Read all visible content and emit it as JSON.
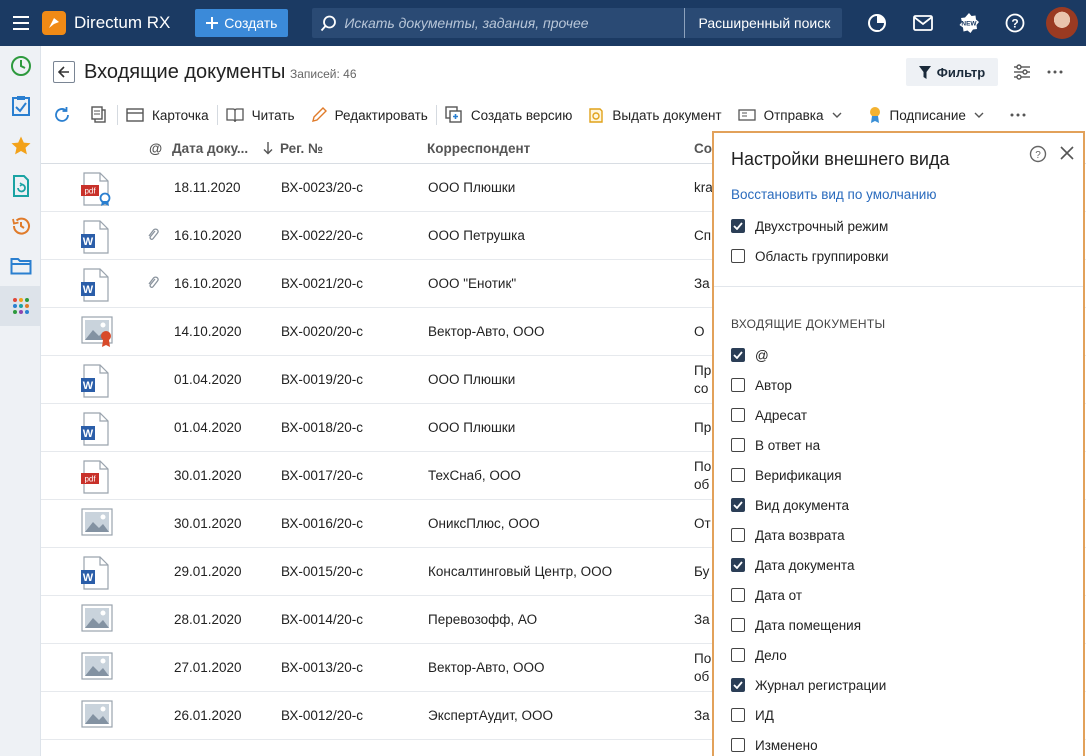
{
  "app": {
    "title": "Directum RX",
    "create_label": "Создать",
    "search_placeholder": "Искать документы, задания, прочее",
    "advanced_search": "Расширенный поиск"
  },
  "page": {
    "title": "Входящие документы",
    "count": "Записей: 46",
    "filter_label": "Фильтр"
  },
  "toolbar": {
    "card": "Карточка",
    "read": "Читать",
    "edit": "Редактировать",
    "create_version": "Создать версию",
    "issue_doc": "Выдать документ",
    "send": "Отправка",
    "sign": "Подписание"
  },
  "columns": {
    "at": "@",
    "date": "Дата доку...",
    "reg": "Рег. №",
    "corr": "Корреспондент",
    "content": "Со"
  },
  "rows": [
    {
      "icon": "pdf-signed",
      "attach": false,
      "date": "18.11.2020",
      "reg": "ВХ-0023/20-с",
      "corr": "ООО Плюшки",
      "c1": "kra",
      "c2": ""
    },
    {
      "icon": "word",
      "attach": true,
      "date": "16.10.2020",
      "reg": "ВХ-0022/20-с",
      "corr": "ООО Петрушка",
      "c1": "Сп",
      "c2": ""
    },
    {
      "icon": "word",
      "attach": true,
      "date": "16.10.2020",
      "reg": "ВХ-0021/20-с",
      "corr": "ООО \"Енотик\"",
      "c1": "За",
      "c2": ""
    },
    {
      "icon": "image-signed",
      "attach": false,
      "date": "14.10.2020",
      "reg": "ВХ-0020/20-с",
      "corr": "Вектор-Авто, ООО",
      "c1": "О",
      "c2": ""
    },
    {
      "icon": "word",
      "attach": false,
      "date": "01.04.2020",
      "reg": "ВХ-0019/20-с",
      "corr": "ООО Плюшки",
      "c1": "Пр",
      "c2": "со"
    },
    {
      "icon": "word",
      "attach": false,
      "date": "01.04.2020",
      "reg": "ВХ-0018/20-с",
      "corr": "ООО Плюшки",
      "c1": "Пр",
      "c2": ""
    },
    {
      "icon": "pdf",
      "attach": false,
      "date": "30.01.2020",
      "reg": "ВХ-0017/20-с",
      "corr": "ТехСнаб, ООО",
      "c1": "По",
      "c2": "об"
    },
    {
      "icon": "image",
      "attach": false,
      "date": "30.01.2020",
      "reg": "ВХ-0016/20-с",
      "corr": "ОниксПлюс, ООО",
      "c1": "От",
      "c2": ""
    },
    {
      "icon": "word",
      "attach": false,
      "date": "29.01.2020",
      "reg": "ВХ-0015/20-с",
      "corr": "Консалтинговый Центр, ООО",
      "c1": "Бу",
      "c2": ""
    },
    {
      "icon": "image",
      "attach": false,
      "date": "28.01.2020",
      "reg": "ВХ-0014/20-с",
      "corr": "Перевозофф, АО",
      "c1": "За",
      "c2": ""
    },
    {
      "icon": "image",
      "attach": false,
      "date": "27.01.2020",
      "reg": "ВХ-0013/20-с",
      "corr": "Вектор-Авто, ООО",
      "c1": "По",
      "c2": "об"
    },
    {
      "icon": "image",
      "attach": false,
      "date": "26.01.2020",
      "reg": "ВХ-0012/20-с",
      "corr": "ЭкспертАудит, ООО",
      "c1": "За",
      "c2": ""
    }
  ],
  "panel": {
    "title": "Настройки внешнего вида",
    "restore": "Восстановить вид по умолчанию",
    "options": [
      {
        "label": "Двухстрочный режим",
        "checked": true
      },
      {
        "label": "Область группировки",
        "checked": false
      }
    ],
    "section": "ВХОДЯЩИЕ ДОКУМЕНТЫ",
    "fields": [
      {
        "label": "@",
        "checked": true
      },
      {
        "label": "Автор",
        "checked": false
      },
      {
        "label": "Адресат",
        "checked": false
      },
      {
        "label": "В ответ на",
        "checked": false
      },
      {
        "label": "Верификация",
        "checked": false
      },
      {
        "label": "Вид документа",
        "checked": true
      },
      {
        "label": "Дата возврата",
        "checked": false
      },
      {
        "label": "Дата документа",
        "checked": true
      },
      {
        "label": "Дата от",
        "checked": false
      },
      {
        "label": "Дата помещения",
        "checked": false
      },
      {
        "label": "Дело",
        "checked": false
      },
      {
        "label": "Журнал регистрации",
        "checked": true
      },
      {
        "label": "ИД",
        "checked": false
      },
      {
        "label": "Изменено",
        "checked": false
      }
    ]
  },
  "colors": {
    "topbar": "#1b3a63",
    "accent": "#3b8ad9",
    "panel_border": "#e2a15a",
    "link": "#2a6bbd"
  }
}
